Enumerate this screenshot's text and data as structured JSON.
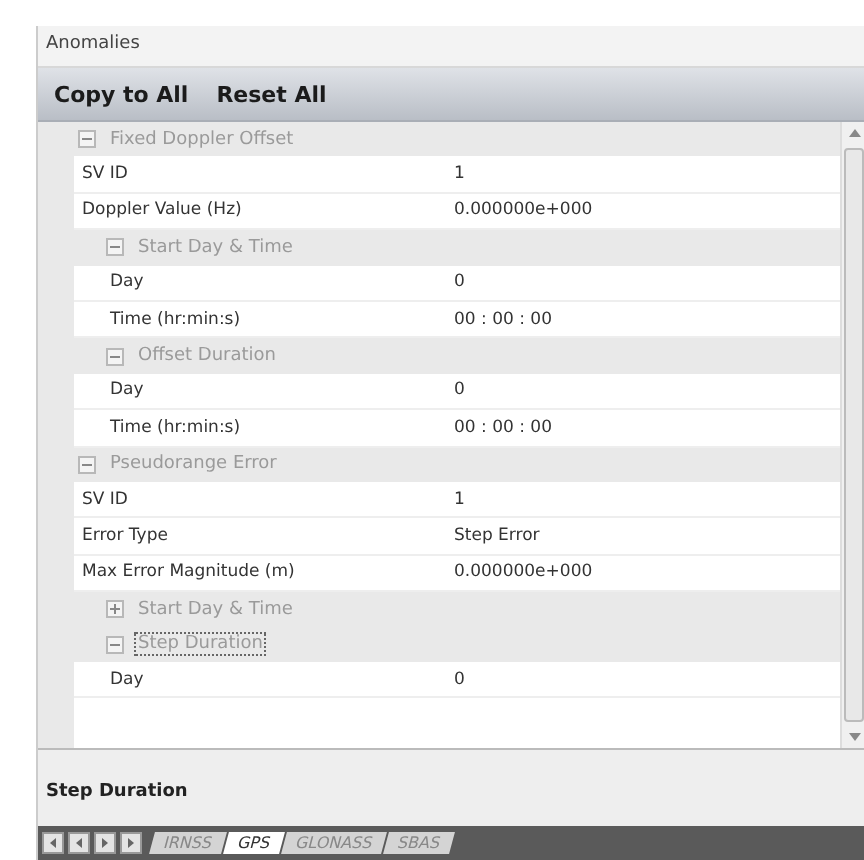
{
  "panel": {
    "title": "Anomalies"
  },
  "toolbar": [
    "Copy to All",
    "Reset All"
  ],
  "grid": [
    {
      "kind": "category",
      "label": "Fixed Doppler Offset",
      "expanded": true,
      "selected": false,
      "children": [
        {
          "kind": "property",
          "label": "SV ID",
          "value": "1"
        },
        {
          "kind": "property",
          "label": "Doppler Value (Hz)",
          "value": "0.000000e+000"
        },
        {
          "kind": "category",
          "label": "Start Day & Time",
          "expanded": true,
          "selected": false,
          "children": [
            {
              "kind": "property",
              "label": "Day",
              "value": "0"
            },
            {
              "kind": "property",
              "label": "Time (hr:min:s)",
              "value": "00 : 00 : 00"
            }
          ]
        },
        {
          "kind": "category",
          "label": "Offset Duration",
          "expanded": true,
          "selected": false,
          "children": [
            {
              "kind": "property",
              "label": "Day",
              "value": "0"
            },
            {
              "kind": "property",
              "label": "Time (hr:min:s)",
              "value": "00 : 00 : 00"
            }
          ]
        }
      ]
    },
    {
      "kind": "category",
      "label": "Pseudorange Error",
      "expanded": true,
      "selected": false,
      "children": [
        {
          "kind": "property",
          "label": "SV ID",
          "value": "1"
        },
        {
          "kind": "property",
          "label": "Error Type",
          "value": "Step Error"
        },
        {
          "kind": "property",
          "label": "Max Error Magnitude (m)",
          "value": "0.000000e+000"
        },
        {
          "kind": "category",
          "label": "Start Day & Time",
          "expanded": false,
          "selected": false
        },
        {
          "kind": "category",
          "label": "Step Duration",
          "expanded": true,
          "selected": true,
          "children": [
            {
              "kind": "property",
              "label": "Day",
              "value": "0"
            }
          ]
        }
      ]
    }
  ],
  "description": {
    "title": "Step Duration"
  },
  "tabs": [
    {
      "label": "IRNSS",
      "selected": false
    },
    {
      "label": "GPS",
      "selected": true
    },
    {
      "label": "GLONASS",
      "selected": false
    },
    {
      "label": "SBAS",
      "selected": false
    }
  ]
}
